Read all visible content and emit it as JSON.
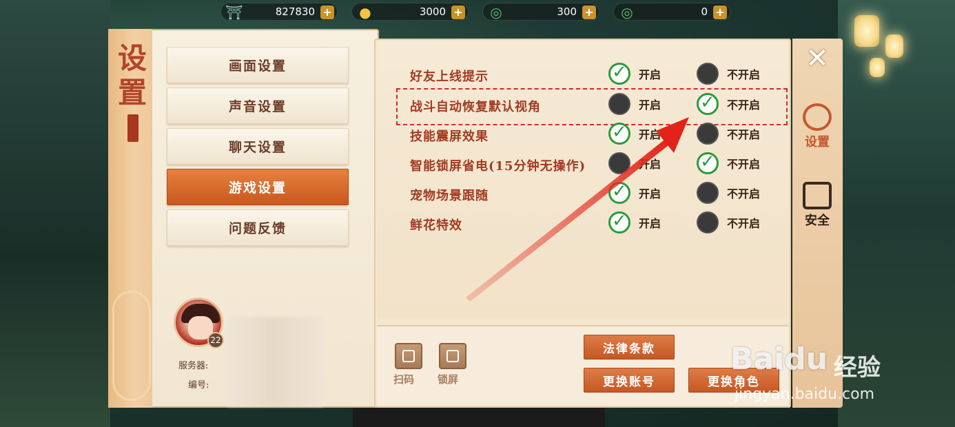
{
  "currencies": [
    {
      "icon": "jade-gate-icon",
      "value": "827830"
    },
    {
      "icon": "gold-ingot-icon",
      "value": "3000"
    },
    {
      "icon": "green-jade-bound-icon",
      "value": "300"
    },
    {
      "icon": "green-jade-icon",
      "value": "0"
    }
  ],
  "panel": {
    "title": "设置",
    "menu": [
      {
        "label": "画面设置",
        "active": false
      },
      {
        "label": "声音设置",
        "active": false
      },
      {
        "label": "聊天设置",
        "active": false
      },
      {
        "label": "游戏设置",
        "active": true
      },
      {
        "label": "问题反馈",
        "active": false
      }
    ],
    "profile": {
      "level": "22",
      "server_label": "服务器:",
      "id_label": "编号:"
    }
  },
  "settings": {
    "on_label": "开启",
    "off_label": "不开启",
    "rows": [
      {
        "label": "好友上线提示",
        "selected": "on"
      },
      {
        "label": "战斗自动恢复默认视角",
        "selected": "off"
      },
      {
        "label": "技能震屏效果",
        "selected": "on"
      },
      {
        "label": "智能锁屏省电(15分钟无操作)",
        "selected": "off"
      },
      {
        "label": "宠物场景跟随",
        "selected": "on"
      },
      {
        "label": "鲜花特效",
        "selected": "on"
      }
    ]
  },
  "tools": {
    "scan_label": "扫码",
    "lock_label": "锁屏"
  },
  "actions": {
    "legal_label": "法律条款",
    "switch_account_label": "更换账号",
    "switch_role_label": "更换角色"
  },
  "side_tabs": [
    {
      "label": "设置",
      "icon": "gear-icon",
      "active": true
    },
    {
      "label": "安全",
      "icon": "shield-lock-icon",
      "active": false
    }
  ],
  "watermark": {
    "logo": "Baidu",
    "text": "经验",
    "url": "jingyan.baidu.com"
  },
  "colors": {
    "accent_orange": "#c9571f",
    "label_red": "#a33a22",
    "check_green": "#2a9b3a",
    "highlight_red": "#d7262c"
  }
}
